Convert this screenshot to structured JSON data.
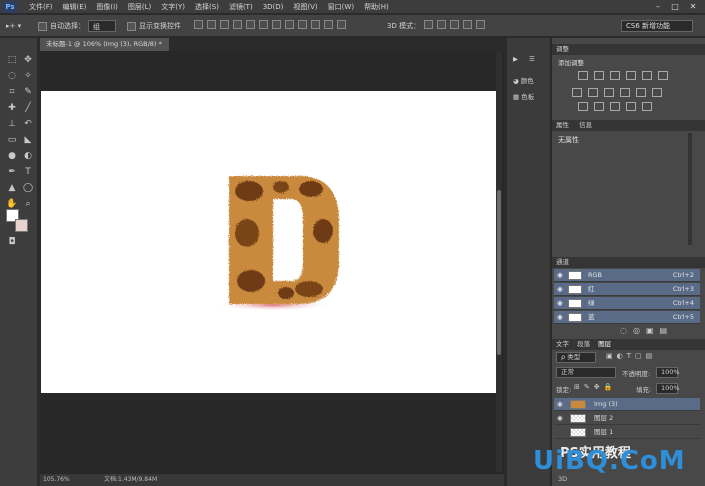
{
  "app": {
    "logo": "Ps"
  },
  "menubar": {
    "items": [
      "文件(F)",
      "编辑(E)",
      "图像(I)",
      "图层(L)",
      "文字(Y)",
      "选择(S)",
      "滤镜(T)",
      "3D(D)",
      "视图(V)",
      "窗口(W)",
      "帮助(H)"
    ]
  },
  "window_controls": {
    "minimize": "–",
    "maximize": "□",
    "close": "✕"
  },
  "options": {
    "auto_select_label": "自动选择：",
    "auto_select_value": "组",
    "show_transform_label": "显示变换控件",
    "mode_3d_label": "3D 模式：",
    "workspace": "CS6 新增功能"
  },
  "document": {
    "tab_title": "未标题-1 @ 106% (Img (3), RGB/8) *",
    "zoom": "105.76%",
    "doc_info": "文档:1.43M/9.84M"
  },
  "dock": {
    "swatches_label": "颜色",
    "styles_label": "色板"
  },
  "adjustments": {
    "tab": "调整",
    "title": "添加调整"
  },
  "properties": {
    "tabs": [
      "属性",
      "信息"
    ],
    "content": "无属性"
  },
  "channels": {
    "tab": "通道",
    "rows": [
      {
        "name": "RGB",
        "shortcut": "Ctrl+2"
      },
      {
        "name": "红",
        "shortcut": "Ctrl+3"
      },
      {
        "name": "绿",
        "shortcut": "Ctrl+4"
      },
      {
        "name": "蓝",
        "shortcut": "Ctrl+5"
      }
    ]
  },
  "layers": {
    "tabs": [
      "文字",
      "段落",
      "图层"
    ],
    "filter_label": "ρ 类型",
    "blend_mode": "正常",
    "opacity_label": "不透明度:",
    "opacity": "100%",
    "lock_label": "锁定:",
    "fill_label": "填充:",
    "fill": "100%",
    "items": [
      {
        "name": "Img (3)"
      },
      {
        "name": "图层 2"
      },
      {
        "name": "图层 1"
      }
    ],
    "bottom_label": "3D"
  },
  "watermark": {
    "text": "UiBQ.CoM",
    "sub": "PS实用教程"
  },
  "colors": {
    "accent": "#2e8fd8",
    "channel_row": "#5a6b88"
  }
}
